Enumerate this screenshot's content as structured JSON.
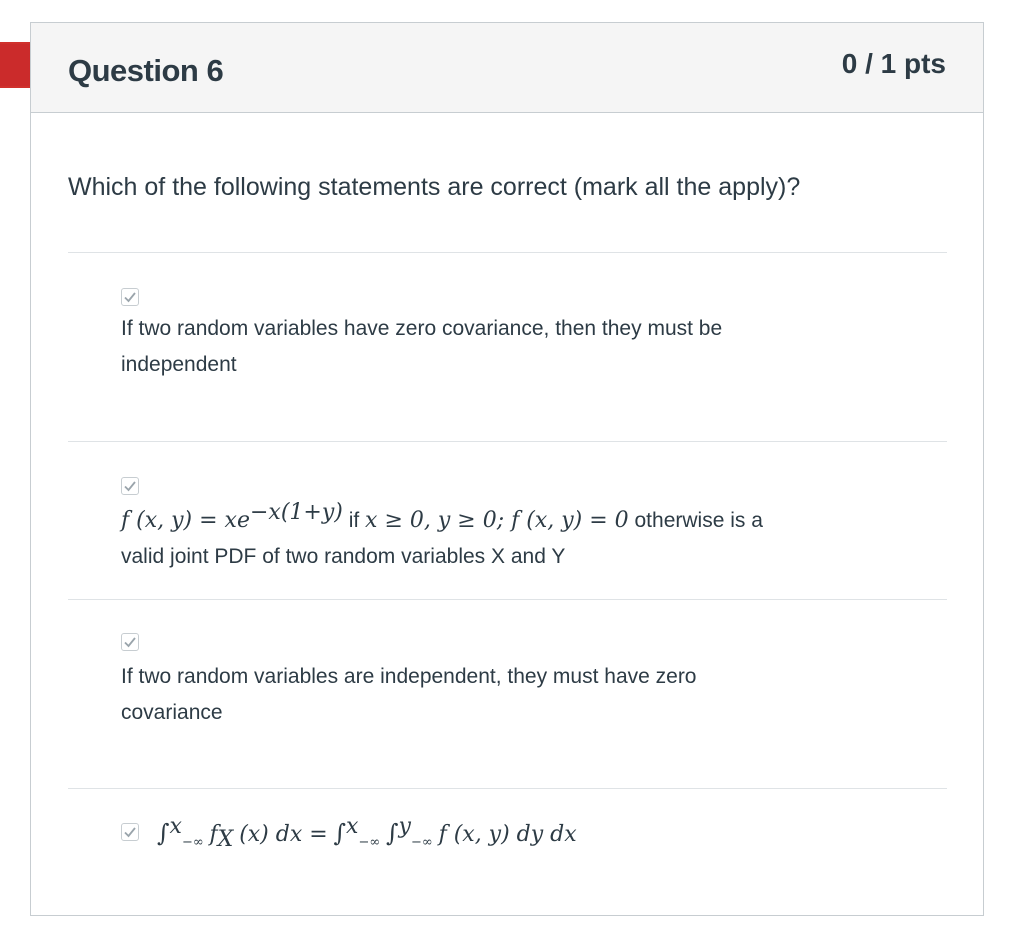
{
  "question": {
    "title": "Question 6",
    "points": "0 / 1 pts",
    "prompt": "Which of the following statements are correct (mark all the apply)?"
  },
  "answers": [
    {
      "text_line1": "If two random variables have zero covariance, then they must be",
      "text_line2": "independent",
      "checked": true
    },
    {
      "math_f": "f (x, y) = xe",
      "math_exp": "−x(1+y)",
      "word_if": "if",
      "math_cond": "x ≥ 0,  y ≥ 0; f (x, y) = 0",
      "word_otherwise": "otherwise is a",
      "text_line2": "valid joint PDF of two random variables X and Y",
      "checked": true
    },
    {
      "text_line1": "If two random variables are independent, they must have zero",
      "text_line2": "covariance",
      "checked": true
    },
    {
      "int1_sup": "x",
      "int1_sub": "−∞",
      "left_body": "f",
      "left_sub": "X",
      "left_rest": "(x) dx =",
      "int2_sup": "x",
      "int2_sub": "−∞",
      "int3_sup": "y",
      "int3_sub": "−∞",
      "right_body": "f (x, y) dy dx",
      "checked": true
    }
  ],
  "colors": {
    "flag": "#d0312d",
    "text": "#2d3b45",
    "header_bg": "#f5f5f5",
    "border": "#c7cdd1"
  }
}
